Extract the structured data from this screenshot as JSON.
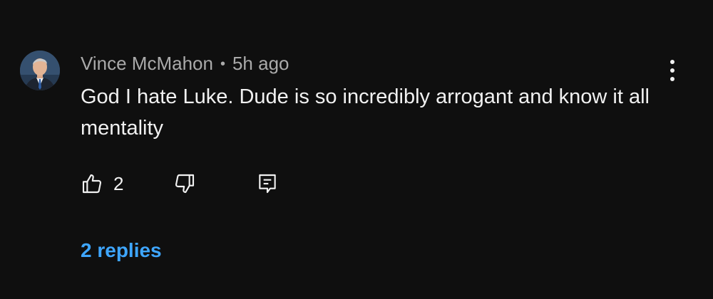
{
  "comment": {
    "author": "Vince McMahon",
    "separator": "•",
    "time": "5h ago",
    "text": "God I hate Luke. Dude is so incredibly arrogant and know it all mentality",
    "like_count": "2",
    "replies_label": "2 replies"
  },
  "icons": {
    "like": "thumbs-up-icon",
    "dislike": "thumbs-down-icon",
    "reply": "comment-reply-icon",
    "more": "more-vertical-icon"
  },
  "colors": {
    "background": "#0f0f0f",
    "text": "#f1f1f1",
    "meta": "#aaaaaa",
    "link": "#3ea6ff"
  }
}
